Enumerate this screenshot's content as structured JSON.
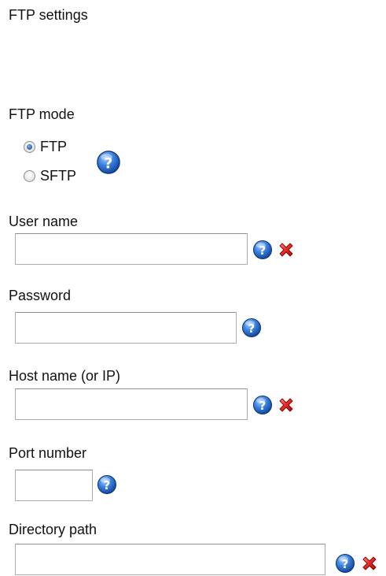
{
  "section": {
    "title": "FTP settings"
  },
  "ftp_mode": {
    "label": "FTP mode",
    "options": [
      {
        "label": "FTP",
        "selected": true
      },
      {
        "label": "SFTP",
        "selected": false
      }
    ]
  },
  "user_name": {
    "label": "User name",
    "value": ""
  },
  "password": {
    "label": "Password",
    "value": ""
  },
  "host_name": {
    "label": "Host name (or IP)",
    "value": ""
  },
  "port_number": {
    "label": "Port number",
    "value": ""
  },
  "directory_path": {
    "label": "Directory path",
    "value": ""
  },
  "icons": {
    "help": "question-mark-icon",
    "clear": "red-x-icon"
  },
  "colors": {
    "help_blue": "#1f5fbf",
    "clear_red": "#d42020",
    "field_border": "#abadb3"
  }
}
